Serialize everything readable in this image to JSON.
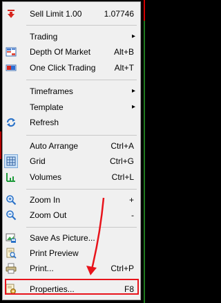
{
  "menu": {
    "items": [
      {
        "label": "Sell Limit 1.00",
        "shortcut": "1.07746",
        "icon": "sell-limit-arrow-icon",
        "submenu": false
      },
      {
        "label": "Trading",
        "shortcut": "",
        "icon": "",
        "submenu": true
      },
      {
        "label": "Depth Of Market",
        "shortcut": "Alt+B",
        "icon": "depth-of-market-icon",
        "submenu": false
      },
      {
        "label": "One Click Trading",
        "shortcut": "Alt+T",
        "icon": "one-click-trading-icon",
        "submenu": false
      },
      {
        "label": "Timeframes",
        "shortcut": "",
        "icon": "",
        "submenu": true
      },
      {
        "label": "Template",
        "shortcut": "",
        "icon": "",
        "submenu": true
      },
      {
        "label": "Refresh",
        "shortcut": "",
        "icon": "refresh-icon",
        "submenu": false
      },
      {
        "label": "Auto Arrange",
        "shortcut": "Ctrl+A",
        "icon": "",
        "submenu": false
      },
      {
        "label": "Grid",
        "shortcut": "Ctrl+G",
        "icon": "grid-icon",
        "submenu": false
      },
      {
        "label": "Volumes",
        "shortcut": "Ctrl+L",
        "icon": "volumes-icon",
        "submenu": false
      },
      {
        "label": "Zoom In",
        "shortcut": "+",
        "icon": "zoom-in-icon",
        "submenu": false
      },
      {
        "label": "Zoom Out",
        "shortcut": "-",
        "icon": "zoom-out-icon",
        "submenu": false
      },
      {
        "label": "Save As Picture...",
        "shortcut": "",
        "icon": "save-as-picture-icon",
        "submenu": false
      },
      {
        "label": "Print Preview",
        "shortcut": "",
        "icon": "print-preview-icon",
        "submenu": false
      },
      {
        "label": "Print...",
        "shortcut": "Ctrl+P",
        "icon": "printer-icon",
        "submenu": false
      },
      {
        "label": "Properties...",
        "shortcut": "F8",
        "icon": "properties-icon",
        "submenu": false
      }
    ]
  },
  "colors": {
    "menu_background": "#f0f0f0",
    "highlight_border": "#e8131b",
    "annotation_arrow": "#e8131b"
  }
}
